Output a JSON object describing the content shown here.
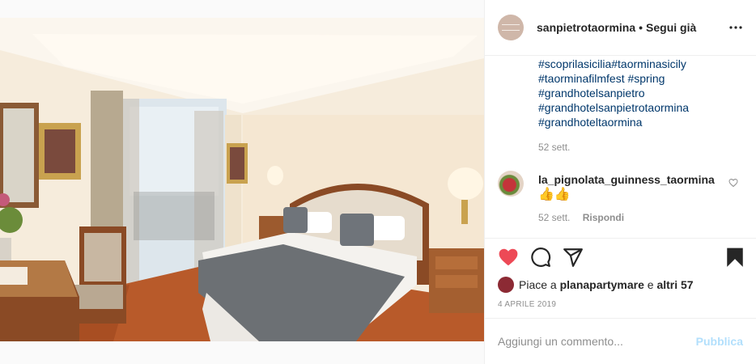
{
  "post": {
    "username": "sanpietrotaormina",
    "separator": "•",
    "follow_label": "Segui già"
  },
  "caption": {
    "hashtags": [
      "#scoprilasicilia#taorminasicily",
      "#taorminafilmfest #spring",
      "#grandhotelsanpietro",
      "#grandhotelsanpietrotaormina",
      "#grandhoteltaormina"
    ],
    "time": "52 sett."
  },
  "comment": {
    "username": "la_pignolata_guinness_taormina",
    "text": "👍👍",
    "time": "52 sett.",
    "reply_label": "Rispondi"
  },
  "likes": {
    "prefix": "Piace a",
    "user": "planapartymare",
    "conj": "e",
    "others": "altri 57"
  },
  "date": "4 APRILE 2019",
  "add_comment": {
    "placeholder": "Aggiungi un commento...",
    "publish_label": "Pubblica"
  },
  "colors": {
    "like_red": "#ed4956",
    "hashtag_blue": "#00376b",
    "publish_disabled": "#b2dffc"
  },
  "icons": [
    "more-icon",
    "heart-icon",
    "comment-icon",
    "share-icon",
    "bookmark-icon",
    "small-heart-icon"
  ]
}
